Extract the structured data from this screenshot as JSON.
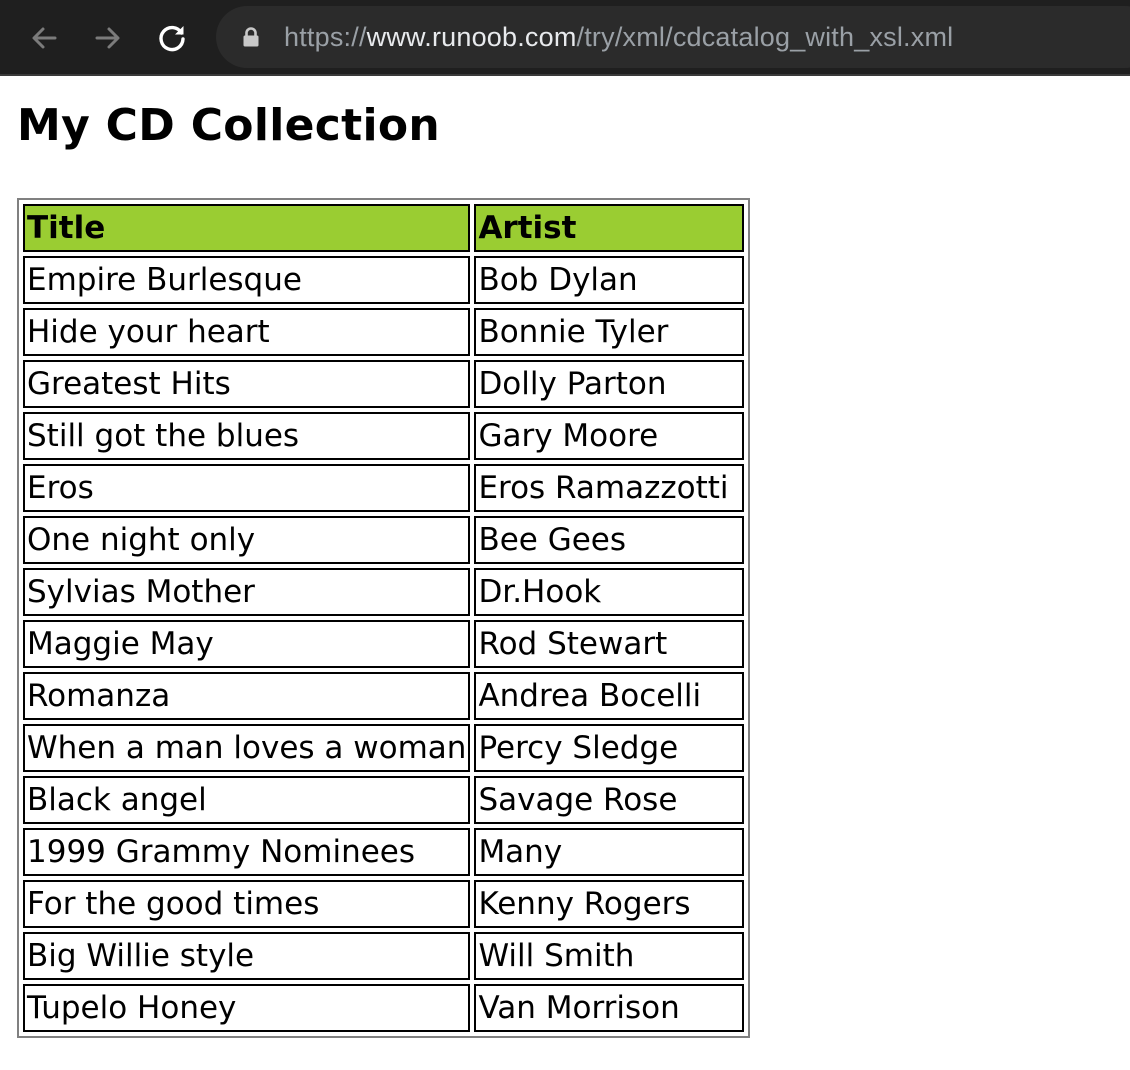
{
  "browser": {
    "url_scheme": "https://",
    "url_host": "www.runoob.com",
    "url_path": "/try/xml/cdcatalog_with_xsl.xml"
  },
  "page": {
    "title": "My CD Collection"
  },
  "table": {
    "header_color": "#9acd32",
    "headers": [
      "Title",
      "Artist"
    ],
    "rows": [
      {
        "title": "Empire Burlesque",
        "artist": "Bob Dylan"
      },
      {
        "title": "Hide your heart",
        "artist": "Bonnie Tyler"
      },
      {
        "title": "Greatest Hits",
        "artist": "Dolly Parton"
      },
      {
        "title": "Still got the blues",
        "artist": "Gary Moore"
      },
      {
        "title": "Eros",
        "artist": "Eros Ramazzotti"
      },
      {
        "title": "One night only",
        "artist": "Bee Gees"
      },
      {
        "title": "Sylvias Mother",
        "artist": "Dr.Hook"
      },
      {
        "title": "Maggie May",
        "artist": "Rod Stewart"
      },
      {
        "title": "Romanza",
        "artist": "Andrea Bocelli"
      },
      {
        "title": "When a man loves a woman",
        "artist": "Percy Sledge"
      },
      {
        "title": "Black angel",
        "artist": "Savage Rose"
      },
      {
        "title": "1999 Grammy Nominees",
        "artist": "Many"
      },
      {
        "title": "For the good times",
        "artist": "Kenny Rogers"
      },
      {
        "title": "Big Willie style",
        "artist": "Will Smith"
      },
      {
        "title": "Tupelo Honey",
        "artist": "Van Morrison"
      }
    ]
  }
}
